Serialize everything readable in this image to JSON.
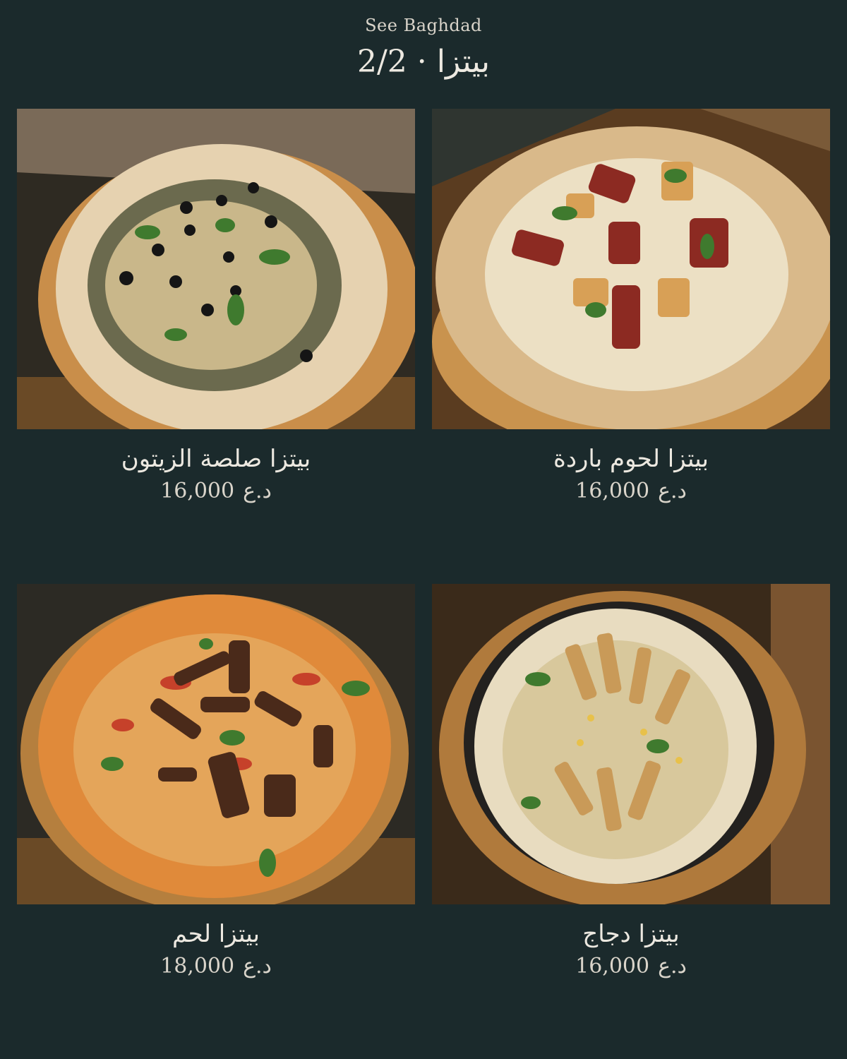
{
  "header": {
    "brand": "See Baghdad",
    "title": "بيتزا · 2/2"
  },
  "currency": "د.ع",
  "items": [
    {
      "name": "بيتزا لحوم باردة",
      "price": "16,000",
      "photo": "cold-cuts-pizza-photo"
    },
    {
      "name": "بيتزا صلصة الزيتون",
      "price": "16,000",
      "photo": "olive-sauce-pizza-photo"
    },
    {
      "name": "بيتزا دجاج",
      "price": "16,000",
      "photo": "chicken-pizza-photo"
    },
    {
      "name": "بيتزا لحم",
      "price": "18,000",
      "photo": "meat-pizza-photo"
    }
  ]
}
